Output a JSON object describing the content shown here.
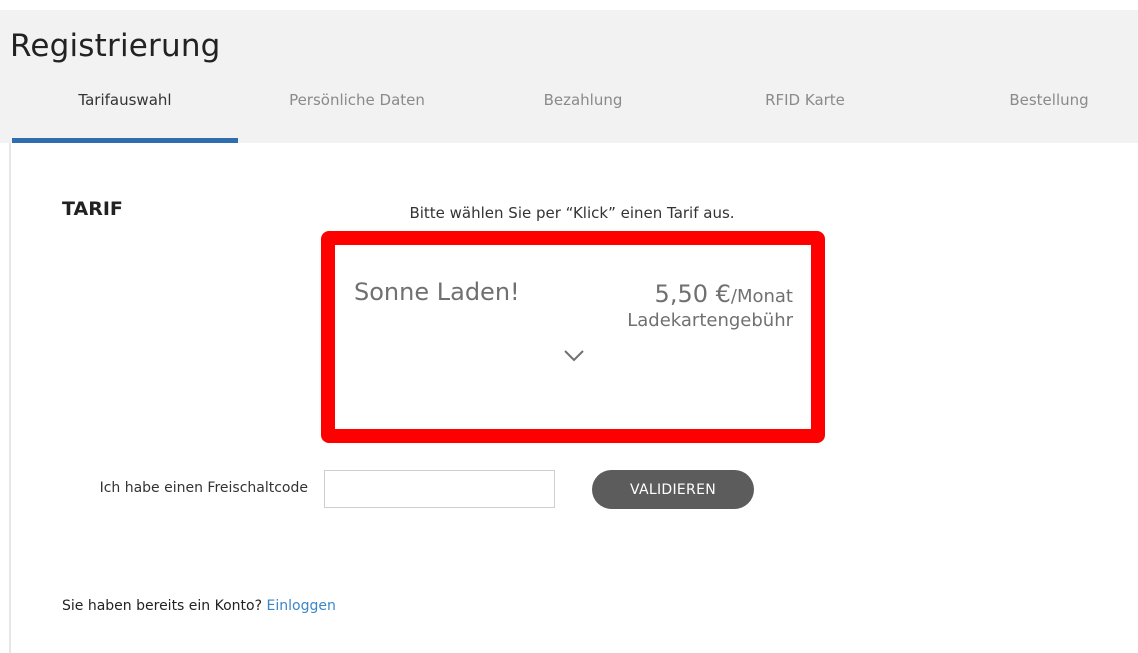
{
  "header": {
    "title": "Registrierung"
  },
  "tabs": [
    {
      "label": "Tarifauswahl",
      "active": true
    },
    {
      "label": "Persönliche Daten",
      "active": false
    },
    {
      "label": "Bezahlung",
      "active": false
    },
    {
      "label": "RFID Karte",
      "active": false
    },
    {
      "label": "Bestellung",
      "active": false
    }
  ],
  "section": {
    "title": "TARIF",
    "instruction": "Bitte wählen Sie per “Klick” einen Tarif aus."
  },
  "tariff": {
    "name": "Sonne Laden!",
    "price": "5,50 €",
    "price_unit": "/Monat",
    "fee_label": "Ladekartengebühr",
    "expand_icon": "chevron-down-icon"
  },
  "voucher": {
    "label": "Ich habe einen Freischaltcode",
    "value": "",
    "placeholder": "",
    "button_label": "VALIDIEREN"
  },
  "login": {
    "prompt": "Sie haben bereits ein Konto?",
    "link_label": "Einloggen"
  },
  "colors": {
    "accent": "#2f6db0",
    "highlight_border": "#ff0000",
    "button_bg": "#5c5c5c",
    "link": "#3a86c8"
  }
}
